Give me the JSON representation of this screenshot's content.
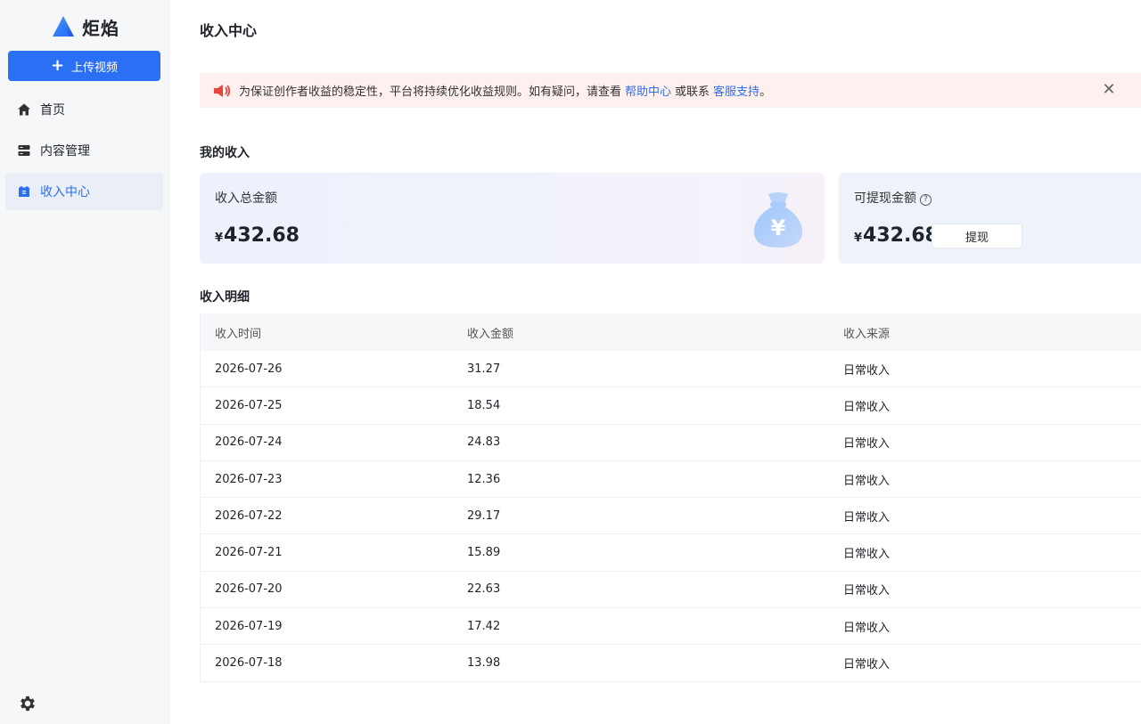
{
  "app": {
    "logo_text": "炬焰",
    "upload_label": "上传视频"
  },
  "sidebar": {
    "items": [
      {
        "label": "首页",
        "icon": "home-icon"
      },
      {
        "label": "内容管理",
        "icon": "content-icon"
      },
      {
        "label": "收入中心",
        "icon": "income-icon",
        "active": true
      }
    ],
    "settings_icon": "gear-icon"
  },
  "header": {
    "title": "收入中心"
  },
  "notice": {
    "text_before": "为保证创作者收益的稳定性，平台将持续优化收益规则。如有疑问，请查看",
    "link1": "帮助中心",
    "text_middle": "或联系",
    "link2": "客服支持",
    "text_after": "。"
  },
  "income": {
    "section_title": "我的收入",
    "total_label": "收入总金额",
    "total_currency": "¥",
    "total_amount": "432.68",
    "available_label": "可提现金额",
    "available_currency": "¥",
    "available_amount": "432.68",
    "withdraw_label": "提现"
  },
  "details": {
    "section_title": "收入明细",
    "columns": [
      "收入时间",
      "收入金额",
      "收入来源"
    ],
    "rows": [
      {
        "date": "2026-07-26",
        "amount": "31.27",
        "source": "日常收入"
      },
      {
        "date": "2026-07-25",
        "amount": "18.54",
        "source": "日常收入"
      },
      {
        "date": "2026-07-24",
        "amount": "24.83",
        "source": "日常收入"
      },
      {
        "date": "2026-07-23",
        "amount": "12.36",
        "source": "日常收入"
      },
      {
        "date": "2026-07-22",
        "amount": "29.17",
        "source": "日常收入"
      },
      {
        "date": "2026-07-21",
        "amount": "15.89",
        "source": "日常收入"
      },
      {
        "date": "2026-07-20",
        "amount": "22.63",
        "source": "日常收入"
      },
      {
        "date": "2026-07-19",
        "amount": "17.42",
        "source": "日常收入"
      },
      {
        "date": "2026-07-18",
        "amount": "13.98",
        "source": "日常收入"
      }
    ]
  },
  "colors": {
    "accent": "#2b6ff5",
    "notice_bg": "#fdf0ee",
    "speaker": "#e8453c"
  }
}
